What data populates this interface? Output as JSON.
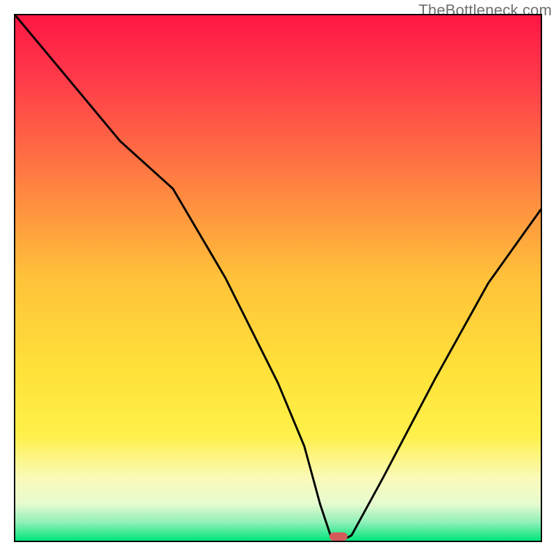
{
  "watermark": "TheBottleneck.com",
  "chart_data": {
    "type": "line",
    "title": "",
    "xlabel": "",
    "ylabel": "",
    "xlim": [
      0,
      100
    ],
    "ylim": [
      0,
      100
    ],
    "series": [
      {
        "name": "curve",
        "x": [
          0,
          10,
          20,
          30,
          40,
          50,
          55,
          58,
          60,
          61,
          62,
          64,
          70,
          80,
          90,
          100
        ],
        "y": [
          100,
          88,
          76,
          67,
          50,
          30,
          18,
          7,
          1,
          0,
          0,
          1,
          12,
          31,
          49,
          63
        ]
      }
    ],
    "marker": {
      "x": 61.5,
      "y": 0,
      "color": "#d45a5a"
    },
    "gradient_stops": [
      {
        "pos": 0.0,
        "color": "#ff1744"
      },
      {
        "pos": 0.12,
        "color": "#ff3a4a"
      },
      {
        "pos": 0.3,
        "color": "#ff7a42"
      },
      {
        "pos": 0.5,
        "color": "#ffc23a"
      },
      {
        "pos": 0.68,
        "color": "#ffe23a"
      },
      {
        "pos": 0.8,
        "color": "#fff04a"
      },
      {
        "pos": 0.88,
        "color": "#fafab8"
      },
      {
        "pos": 0.93,
        "color": "#e7fbd0"
      },
      {
        "pos": 0.965,
        "color": "#8ff0b8"
      },
      {
        "pos": 1.0,
        "color": "#00e47a"
      }
    ],
    "curve_color": "#000000",
    "curve_width": 3
  }
}
